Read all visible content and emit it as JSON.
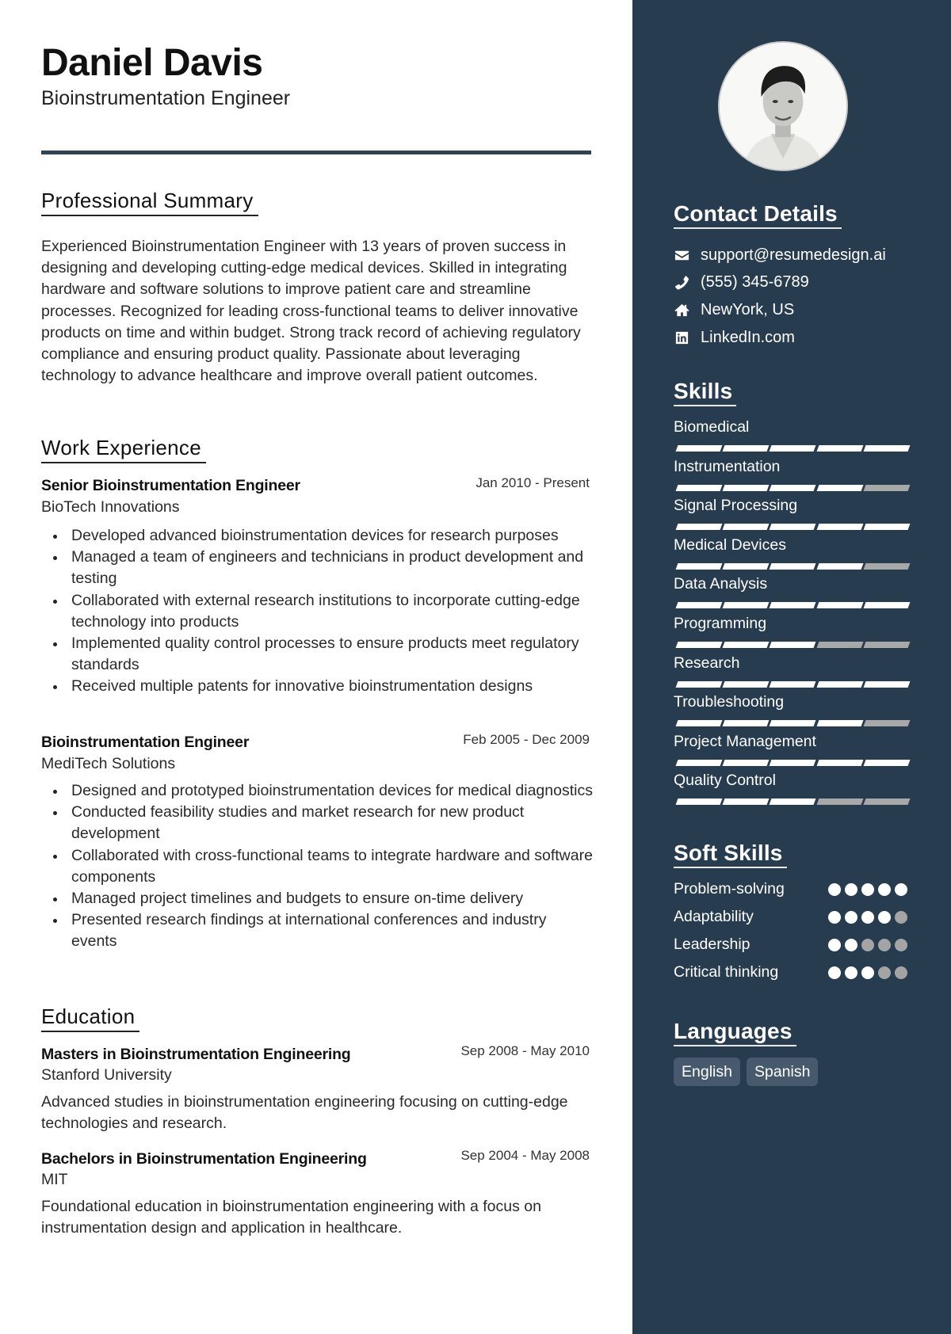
{
  "header": {
    "name": "Daniel Davis",
    "title": "Bioinstrumentation Engineer"
  },
  "summary": {
    "heading": "Professional Summary",
    "text": "Experienced Bioinstrumentation Engineer with 13 years of proven success in designing and developing cutting-edge medical devices. Skilled in integrating hardware and software solutions to improve patient care and streamline processes. Recognized for leading cross-functional teams to deliver innovative products on time and within budget. Strong track record of achieving regulatory compliance and ensuring product quality. Passionate about leveraging technology to advance healthcare and improve overall patient outcomes."
  },
  "experience": {
    "heading": "Work Experience",
    "jobs": [
      {
        "title": "Senior Bioinstrumentation Engineer",
        "dates": "Jan 2010 - Present",
        "company": "BioTech Innovations",
        "bullets": [
          "Developed advanced bioinstrumentation devices for research purposes",
          "Managed a team of engineers and technicians in product development and testing",
          "Collaborated with external research institutions to incorporate cutting-edge technology into products",
          "Implemented quality control processes to ensure products meet regulatory standards",
          "Received multiple patents for innovative bioinstrumentation designs"
        ]
      },
      {
        "title": "Bioinstrumentation Engineer",
        "dates": "Feb 2005 - Dec 2009",
        "company": "MediTech Solutions",
        "bullets": [
          "Designed and prototyped bioinstrumentation devices for medical diagnostics",
          "Conducted feasibility studies and market research for new product development",
          "Collaborated with cross-functional teams to integrate hardware and software components",
          "Managed project timelines and budgets to ensure on-time delivery",
          "Presented research findings at international conferences and industry events"
        ]
      }
    ]
  },
  "education": {
    "heading": "Education",
    "items": [
      {
        "degree": "Masters in Bioinstrumentation Engineering",
        "dates": "Sep 2008 - May 2010",
        "school": "Stanford University",
        "description": "Advanced studies in bioinstrumentation engineering focusing on cutting-edge technologies and research."
      },
      {
        "degree": "Bachelors in Bioinstrumentation Engineering",
        "dates": "Sep 2004 - May 2008",
        "school": "MIT",
        "description": "Foundational education in bioinstrumentation engineering with a focus on instrumentation design and application in healthcare."
      }
    ]
  },
  "sidebar": {
    "photo_alt": "Profile photo",
    "contact": {
      "heading": "Contact Details",
      "items": [
        {
          "icon": "envelope-icon",
          "text": "support@resumedesign.ai"
        },
        {
          "icon": "phone-icon",
          "text": "(555) 345-6789"
        },
        {
          "icon": "home-icon",
          "text": "NewYork, US"
        },
        {
          "icon": "linkedin-icon",
          "text": "LinkedIn.com"
        }
      ]
    },
    "skills": {
      "heading": "Skills",
      "max": 5,
      "items": [
        {
          "label": "Biomedical",
          "level": 5
        },
        {
          "label": "Instrumentation",
          "level": 4
        },
        {
          "label": "Signal Processing",
          "level": 5
        },
        {
          "label": "Medical Devices",
          "level": 4
        },
        {
          "label": "Data Analysis",
          "level": 5
        },
        {
          "label": "Programming",
          "level": 3
        },
        {
          "label": "Research",
          "level": 5
        },
        {
          "label": "Troubleshooting",
          "level": 4
        },
        {
          "label": "Project Management",
          "level": 5
        },
        {
          "label": "Quality Control",
          "level": 3
        }
      ]
    },
    "soft_skills": {
      "heading": "Soft Skills",
      "max": 5,
      "items": [
        {
          "label": "Problem-solving",
          "level": 5
        },
        {
          "label": "Adaptability",
          "level": 4
        },
        {
          "label": "Leadership",
          "level": 2
        },
        {
          "label": "Critical thinking",
          "level": 3
        }
      ]
    },
    "languages": {
      "heading": "Languages",
      "items": [
        "English",
        "Spanish"
      ]
    }
  },
  "colors": {
    "sidebar_bg": "#283c50",
    "header_rule": "#2f4356",
    "rating_on": "#ffffff",
    "rating_off": "#a8a8a8",
    "language_chip": "#475a6d"
  }
}
